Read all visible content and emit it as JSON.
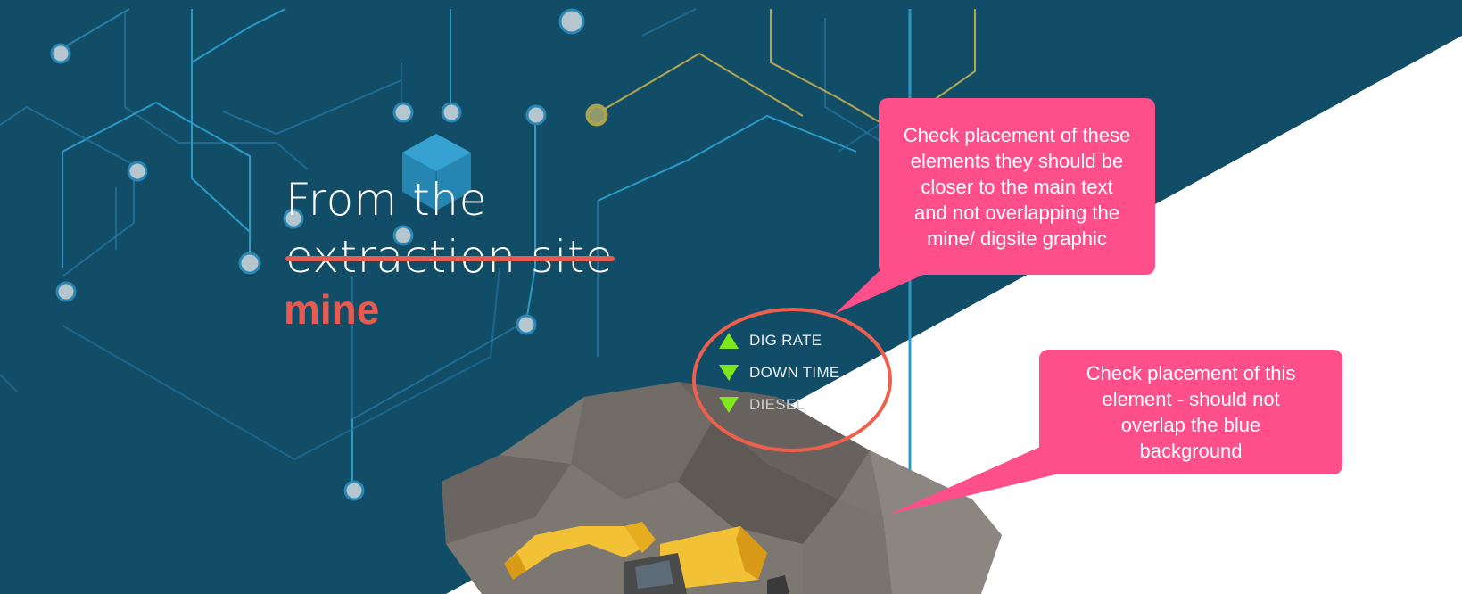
{
  "hero": {
    "line1": "From the",
    "line2_struck": "extraction site",
    "line3": "mine"
  },
  "metrics": [
    {
      "label": "DIG RATE",
      "trend": "up"
    },
    {
      "label": "DOWN TIME",
      "trend": "down"
    },
    {
      "label": "DIESEL",
      "trend": "down"
    }
  ],
  "annotations": [
    {
      "text": "Check placement of these elements they should be closer to the main text and not overlapping the mine/ digsite graphic"
    },
    {
      "text": "Check placement of this element - should not overlap the blue background"
    }
  ],
  "colors": {
    "background_blue": "#124d67",
    "accent_red": "#e85a4f",
    "trend_green": "#7ee81d",
    "callout_pink": "#ff4f8b",
    "circuit_blue": "#2a9bc9",
    "node_grey": "#b5c6cf"
  }
}
